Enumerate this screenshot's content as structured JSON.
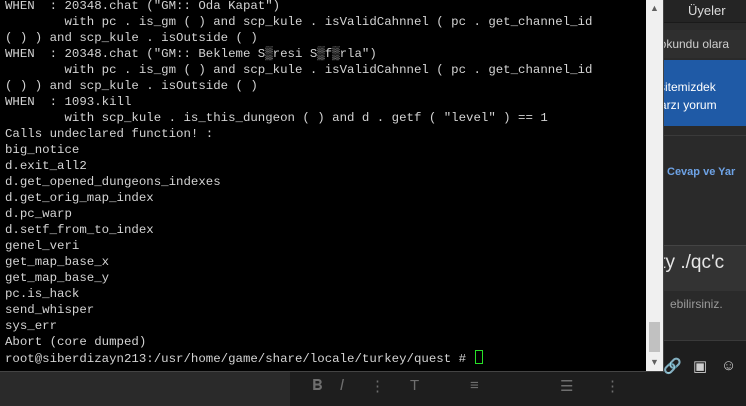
{
  "background": {
    "header_members": "Üyeler",
    "strip_text": "rı okundu olara",
    "notice_line1": "e sitemizdek",
    "notice_line2": "\" tarzı yorum",
    "reply_label": "Cevap ve Yar",
    "title_fragment": "tty ./qc'c",
    "subtitle_fragment": "ebilirsiniz."
  },
  "terminal": {
    "lines": [
      "WHEN  : 20348.chat (\"GM:: Oda Kapat\")",
      "        with pc . is_gm ( ) and scp_kule . isValidCahnnel ( pc . get_channel_id",
      "( ) ) and scp_kule . isOutside ( )",
      "WHEN  : 20348.chat (\"GM:: Bekleme S▒resi S▒f▒rla\")",
      "        with pc . is_gm ( ) and scp_kule . isValidCahnnel ( pc . get_channel_id",
      "( ) ) and scp_kule . isOutside ( )",
      "WHEN  : 1093.kill",
      "        with scp_kule . is_this_dungeon ( ) and d . getf ( \"level\" ) == 1",
      "Calls undeclared function! :",
      "big_notice",
      "d.exit_all2",
      "d.get_opened_dungeons_indexes",
      "d.get_orig_map_index",
      "d.pc_warp",
      "d.setf_from_to_index",
      "genel_veri",
      "get_map_base_x",
      "get_map_base_y",
      "pc.is_hack",
      "send_whisper",
      "sys_err",
      "Abort (core dumped)"
    ],
    "prompt": "root@siberdizayn213:/usr/home/game/share/locale/turkey/quest # "
  },
  "colors": {
    "terminal_bg": "#000000",
    "terminal_fg": "#d4d4d4",
    "cursor": "#28e028",
    "notice_bg": "#1f5aa6"
  }
}
